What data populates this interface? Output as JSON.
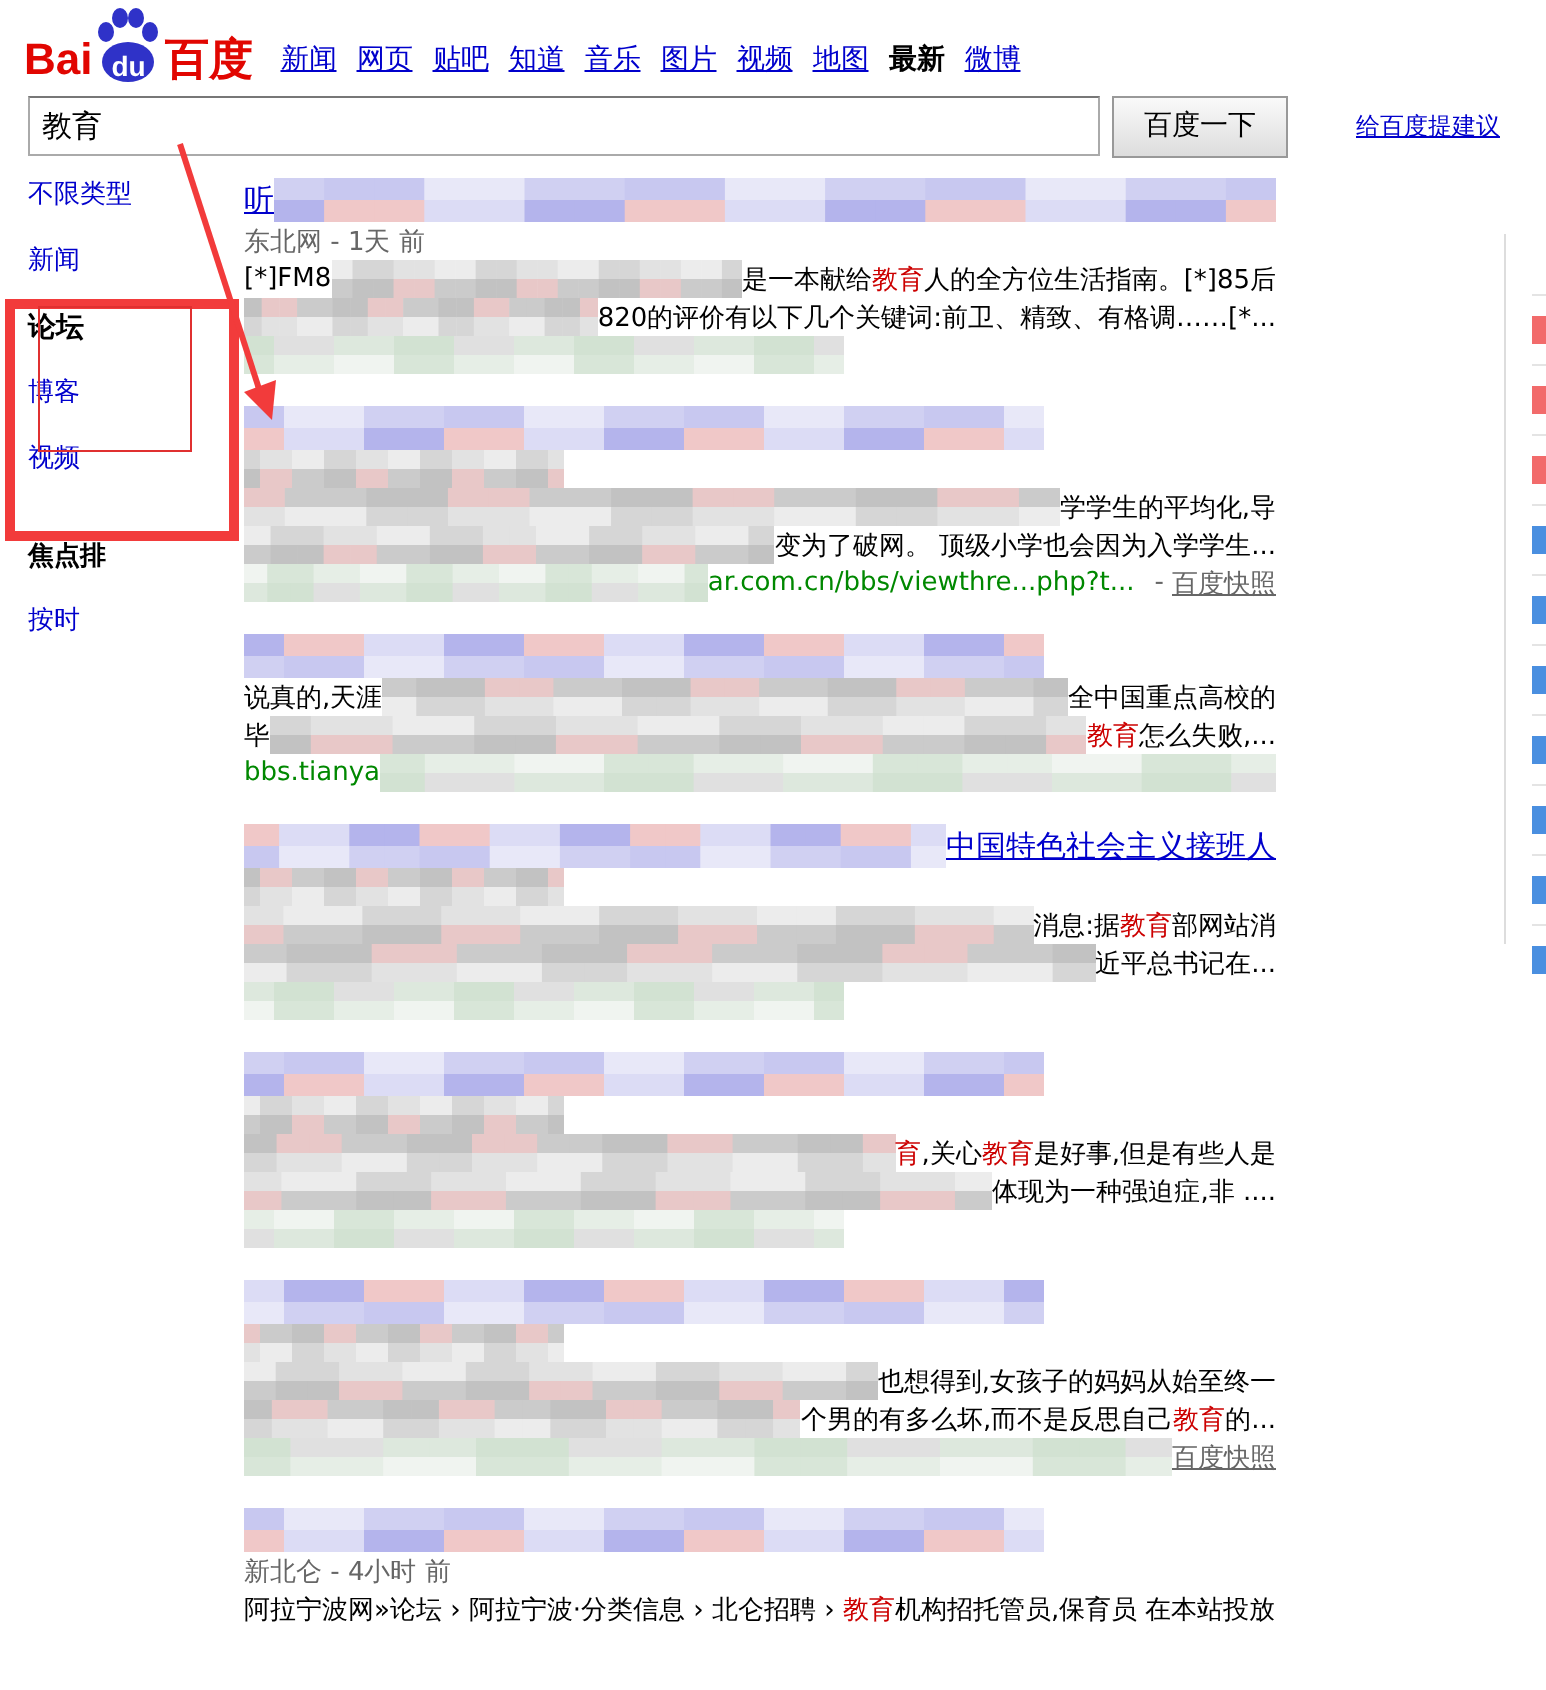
{
  "logo": {
    "left": "Bai",
    "badge": "du",
    "right": "百度"
  },
  "nav": [
    {
      "label": "新闻",
      "selected": false
    },
    {
      "label": "网页",
      "selected": false
    },
    {
      "label": "贴吧",
      "selected": false
    },
    {
      "label": "知道",
      "selected": false
    },
    {
      "label": "音乐",
      "selected": false
    },
    {
      "label": "图片",
      "selected": false
    },
    {
      "label": "视频",
      "selected": false
    },
    {
      "label": "地图",
      "selected": false
    },
    {
      "label": "最新",
      "selected": true
    },
    {
      "label": "微博",
      "selected": false
    }
  ],
  "search": {
    "value": "教育",
    "button": "百度一下",
    "feedback_link": "给百度提建议"
  },
  "sidebar": {
    "items": [
      {
        "label": "不限类型",
        "selected": false
      },
      {
        "label": "新闻",
        "selected": false
      },
      {
        "label": "论坛",
        "selected": true
      },
      {
        "label": "博客",
        "selected": false
      },
      {
        "label": "视频",
        "selected": false
      }
    ],
    "sort": [
      {
        "label": "焦点排",
        "selected": true
      },
      {
        "label": "按时",
        "selected": false
      }
    ]
  },
  "results": [
    {
      "lines": [
        {
          "kind": "title",
          "segments": [
            {
              "kind": "text",
              "text": "听"
            },
            {
              "kind": "mosaic"
            }
          ]
        },
        {
          "kind": "meta",
          "segments": [
            {
              "kind": "text",
              "text": "东北网 - 1天 前"
            }
          ]
        },
        {
          "kind": "snippet",
          "segments": [
            {
              "kind": "text",
              "text": "[*]FM8"
            },
            {
              "kind": "mosaic"
            },
            {
              "kind": "text",
              "text": "是一本献给**教育**人的全方位生活指南。[*]85后"
            }
          ]
        },
        {
          "kind": "snippet",
          "segments": [
            {
              "kind": "mosaic"
            },
            {
              "kind": "text",
              "text": "820的评价有以下几个关键词:前卫、精致、有格调……[*..."
            }
          ]
        },
        {
          "kind": "url",
          "segments": [
            {
              "kind": "mosaic"
            }
          ]
        }
      ]
    },
    {
      "lines": [
        {
          "kind": "title",
          "segments": [
            {
              "kind": "mosaic"
            }
          ]
        },
        {
          "kind": "meta",
          "segments": [
            {
              "kind": "mosaic"
            }
          ]
        },
        {
          "kind": "snippet",
          "segments": [
            {
              "kind": "mosaic"
            },
            {
              "kind": "text",
              "text": "学学生的平均化,导"
            }
          ]
        },
        {
          "kind": "snippet",
          "segments": [
            {
              "kind": "mosaic"
            },
            {
              "kind": "text",
              "text": "变为了破网。 顶级小学也会因为入学学生..."
            }
          ]
        },
        {
          "kind": "url",
          "segments": [
            {
              "kind": "mosaic"
            },
            {
              "kind": "text",
              "text": "ar.com.cn/bbs/viewthre...php?t..."
            },
            {
              "kind": "sep",
              "text": "-"
            },
            {
              "kind": "cache",
              "text": "百度快照"
            }
          ]
        }
      ]
    },
    {
      "lines": [
        {
          "kind": "title",
          "segments": [
            {
              "kind": "mosaic"
            }
          ]
        },
        {
          "kind": "snippet",
          "segments": [
            {
              "kind": "text",
              "text": "说真的,天涯"
            },
            {
              "kind": "mosaic"
            },
            {
              "kind": "text",
              "text": "全中国重点高校的"
            }
          ]
        },
        {
          "kind": "snippet",
          "segments": [
            {
              "kind": "text",
              "text": "毕"
            },
            {
              "kind": "mosaic"
            },
            {
              "kind": "text",
              "text": "**教育**怎么失败,..."
            }
          ]
        },
        {
          "kind": "url",
          "segments": [
            {
              "kind": "text",
              "text": "bbs.tianya"
            },
            {
              "kind": "mosaic"
            }
          ]
        }
      ]
    },
    {
      "lines": [
        {
          "kind": "title",
          "segments": [
            {
              "kind": "mosaic"
            },
            {
              "kind": "text",
              "text": "中国特色社会主义接班人"
            }
          ]
        },
        {
          "kind": "meta",
          "segments": [
            {
              "kind": "mosaic"
            }
          ]
        },
        {
          "kind": "snippet",
          "segments": [
            {
              "kind": "mosaic"
            },
            {
              "kind": "text",
              "text": "消息:据**教育**部网站消"
            }
          ]
        },
        {
          "kind": "snippet",
          "segments": [
            {
              "kind": "mosaic"
            },
            {
              "kind": "text",
              "text": "近平总书记在..."
            }
          ]
        },
        {
          "kind": "url",
          "segments": [
            {
              "kind": "mosaic"
            }
          ]
        }
      ]
    },
    {
      "lines": [
        {
          "kind": "title",
          "segments": [
            {
              "kind": "mosaic"
            }
          ]
        },
        {
          "kind": "meta",
          "segments": [
            {
              "kind": "mosaic"
            }
          ]
        },
        {
          "kind": "snippet",
          "segments": [
            {
              "kind": "mosaic"
            },
            {
              "kind": "text",
              "text": "**育**,关心**教育**是好事,但是有些人是"
            }
          ]
        },
        {
          "kind": "snippet",
          "segments": [
            {
              "kind": "mosaic"
            },
            {
              "kind": "text",
              "text": "体现为一种强迫症,非 ...."
            }
          ]
        },
        {
          "kind": "url",
          "segments": [
            {
              "kind": "mosaic"
            }
          ]
        }
      ]
    },
    {
      "lines": [
        {
          "kind": "title",
          "segments": [
            {
              "kind": "mosaic"
            }
          ]
        },
        {
          "kind": "meta",
          "segments": [
            {
              "kind": "mosaic"
            }
          ]
        },
        {
          "kind": "snippet",
          "segments": [
            {
              "kind": "mosaic"
            },
            {
              "kind": "text",
              "text": "也想得到,女孩子的妈妈从始至终一"
            }
          ]
        },
        {
          "kind": "snippet",
          "segments": [
            {
              "kind": "mosaic"
            },
            {
              "kind": "text",
              "text": "个男的有多么坏,而不是反思自己**教育**的..."
            }
          ]
        },
        {
          "kind": "url",
          "segments": [
            {
              "kind": "mosaic"
            },
            {
              "kind": "cache",
              "text": "百度快照"
            }
          ]
        }
      ]
    },
    {
      "lines": [
        {
          "kind": "title",
          "segments": [
            {
              "kind": "mosaic"
            }
          ]
        },
        {
          "kind": "meta",
          "segments": [
            {
              "kind": "text",
              "text": "新北仑 - 4小时 前"
            }
          ]
        },
        {
          "kind": "snippet",
          "segments": [
            {
              "kind": "text",
              "text": "阿拉宁波网»论坛 › 阿拉宁波·分类信息 › 北仑招聘 › **教育**机构招托管员,保育员 在本站投放"
            }
          ]
        }
      ]
    }
  ],
  "ranking": {
    "items": [
      {
        "color": "#f26b6b"
      },
      {
        "color": "#f26b6b"
      },
      {
        "color": "#f26b6b"
      },
      {
        "color": "#4a8fe0"
      },
      {
        "color": "#4a8fe0"
      },
      {
        "color": "#4a8fe0"
      },
      {
        "color": "#4a8fe0"
      },
      {
        "color": "#4a8fe0"
      },
      {
        "color": "#4a8fe0"
      },
      {
        "color": "#4a8fe0"
      }
    ]
  },
  "annotation": {
    "kind": "box-and-arrow"
  }
}
